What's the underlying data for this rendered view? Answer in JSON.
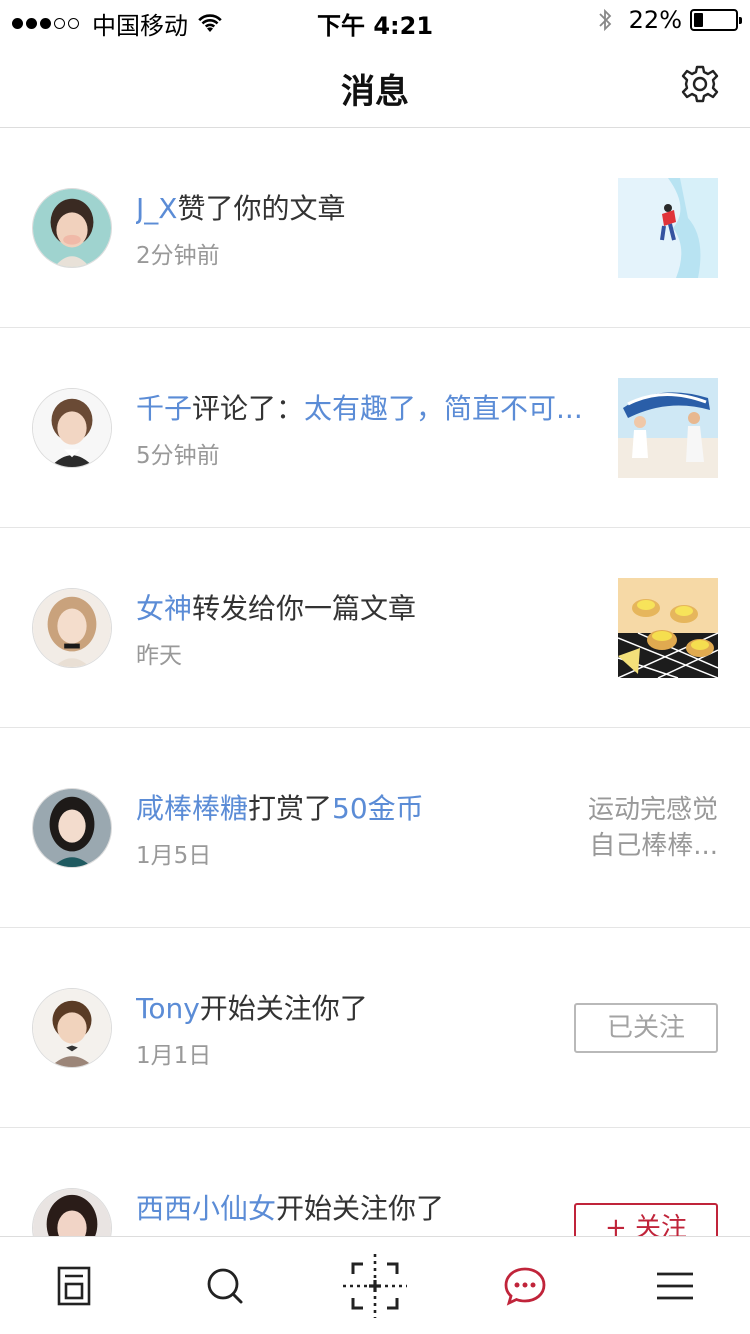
{
  "status_bar": {
    "carrier": "中国移动",
    "time": "下午 4:21",
    "battery_percent": "22%",
    "battery_level": 0.22,
    "signal_bars_filled": 3,
    "signal_bars_total": 5
  },
  "nav": {
    "title": "消息",
    "settings_icon": "gear-icon"
  },
  "colors": {
    "highlight": "#5b8cd6",
    "accent_red": "#c0243a",
    "muted": "#999999"
  },
  "messages": [
    {
      "actor": "J_X",
      "action": "赞了你的文章",
      "detail": "",
      "time": "2分钟前",
      "right": "thumbnail",
      "thumb": "ice-climber"
    },
    {
      "actor": "千子",
      "action": "评论了：",
      "detail": "太有趣了，简直不可...",
      "time": "5分钟前",
      "right": "thumbnail",
      "thumb": "kids-beach"
    },
    {
      "actor": "女神",
      "action": "转发给你一篇文章",
      "detail": "",
      "time": "昨天",
      "right": "thumbnail",
      "thumb": "lemon-tarts"
    },
    {
      "actor": "咸棒棒糖",
      "action": "打赏了",
      "detail": "50金币",
      "time": "1月5日",
      "right": "snippet",
      "snippet_line1": "运动完感觉",
      "snippet_line2": "自己棒棒..."
    },
    {
      "actor": "Tony",
      "action": "开始关注你了",
      "detail": "",
      "time": "1月1日",
      "right": "button",
      "button_label": "已关注"
    },
    {
      "actor": "西西小仙女",
      "action": "开始关注你了",
      "detail": "",
      "time": "",
      "right": "button",
      "button_label": "+ 关注"
    }
  ],
  "tab_bar": {
    "tabs": [
      {
        "icon": "article-icon",
        "active": false
      },
      {
        "icon": "search-icon",
        "active": false
      },
      {
        "icon": "scan-icon",
        "active": false
      },
      {
        "icon": "message-icon",
        "active": true
      },
      {
        "icon": "menu-icon",
        "active": false
      }
    ]
  }
}
